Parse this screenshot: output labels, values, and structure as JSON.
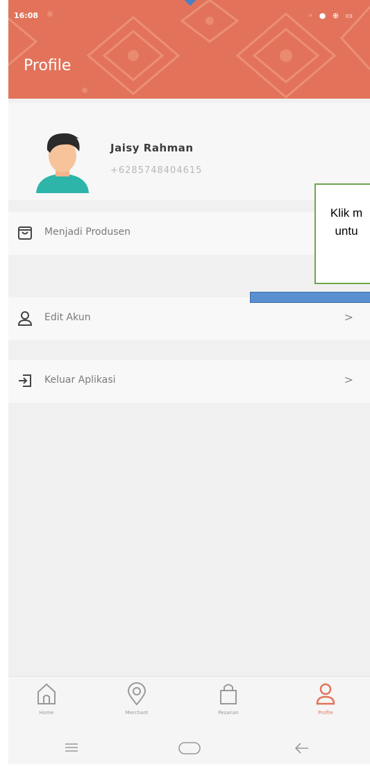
{
  "status_bar": {
    "time": "16:08",
    "icons": "◦ ● ⊕ ▭"
  },
  "header": {
    "title": "Profile"
  },
  "profile": {
    "name": "Jaisy Rahman",
    "phone": "+6285748404615"
  },
  "menu": [
    {
      "label": "Menjadi Produsen",
      "icon": "shopping-bag-icon",
      "chevron": ""
    },
    {
      "label": "Edit Akun",
      "icon": "user-icon",
      "chevron": ">"
    },
    {
      "label": "Keluar Aplikasi",
      "icon": "logout-icon",
      "chevron": ">"
    }
  ],
  "bottom_nav": [
    {
      "label": "Home",
      "icon": "home-icon"
    },
    {
      "label": "Merchant",
      "icon": "location-pin-icon"
    },
    {
      "label": "Pesanan",
      "icon": "bag-icon"
    },
    {
      "label": "Profile",
      "icon": "user-icon",
      "active": true
    }
  ],
  "annotation": {
    "line1": "Klik m",
    "line2": "untu"
  },
  "colors": {
    "header": "#e2735a",
    "accent": "#e2735a",
    "callout_border": "#6ea64b",
    "arrow": "#5a8fd0"
  }
}
